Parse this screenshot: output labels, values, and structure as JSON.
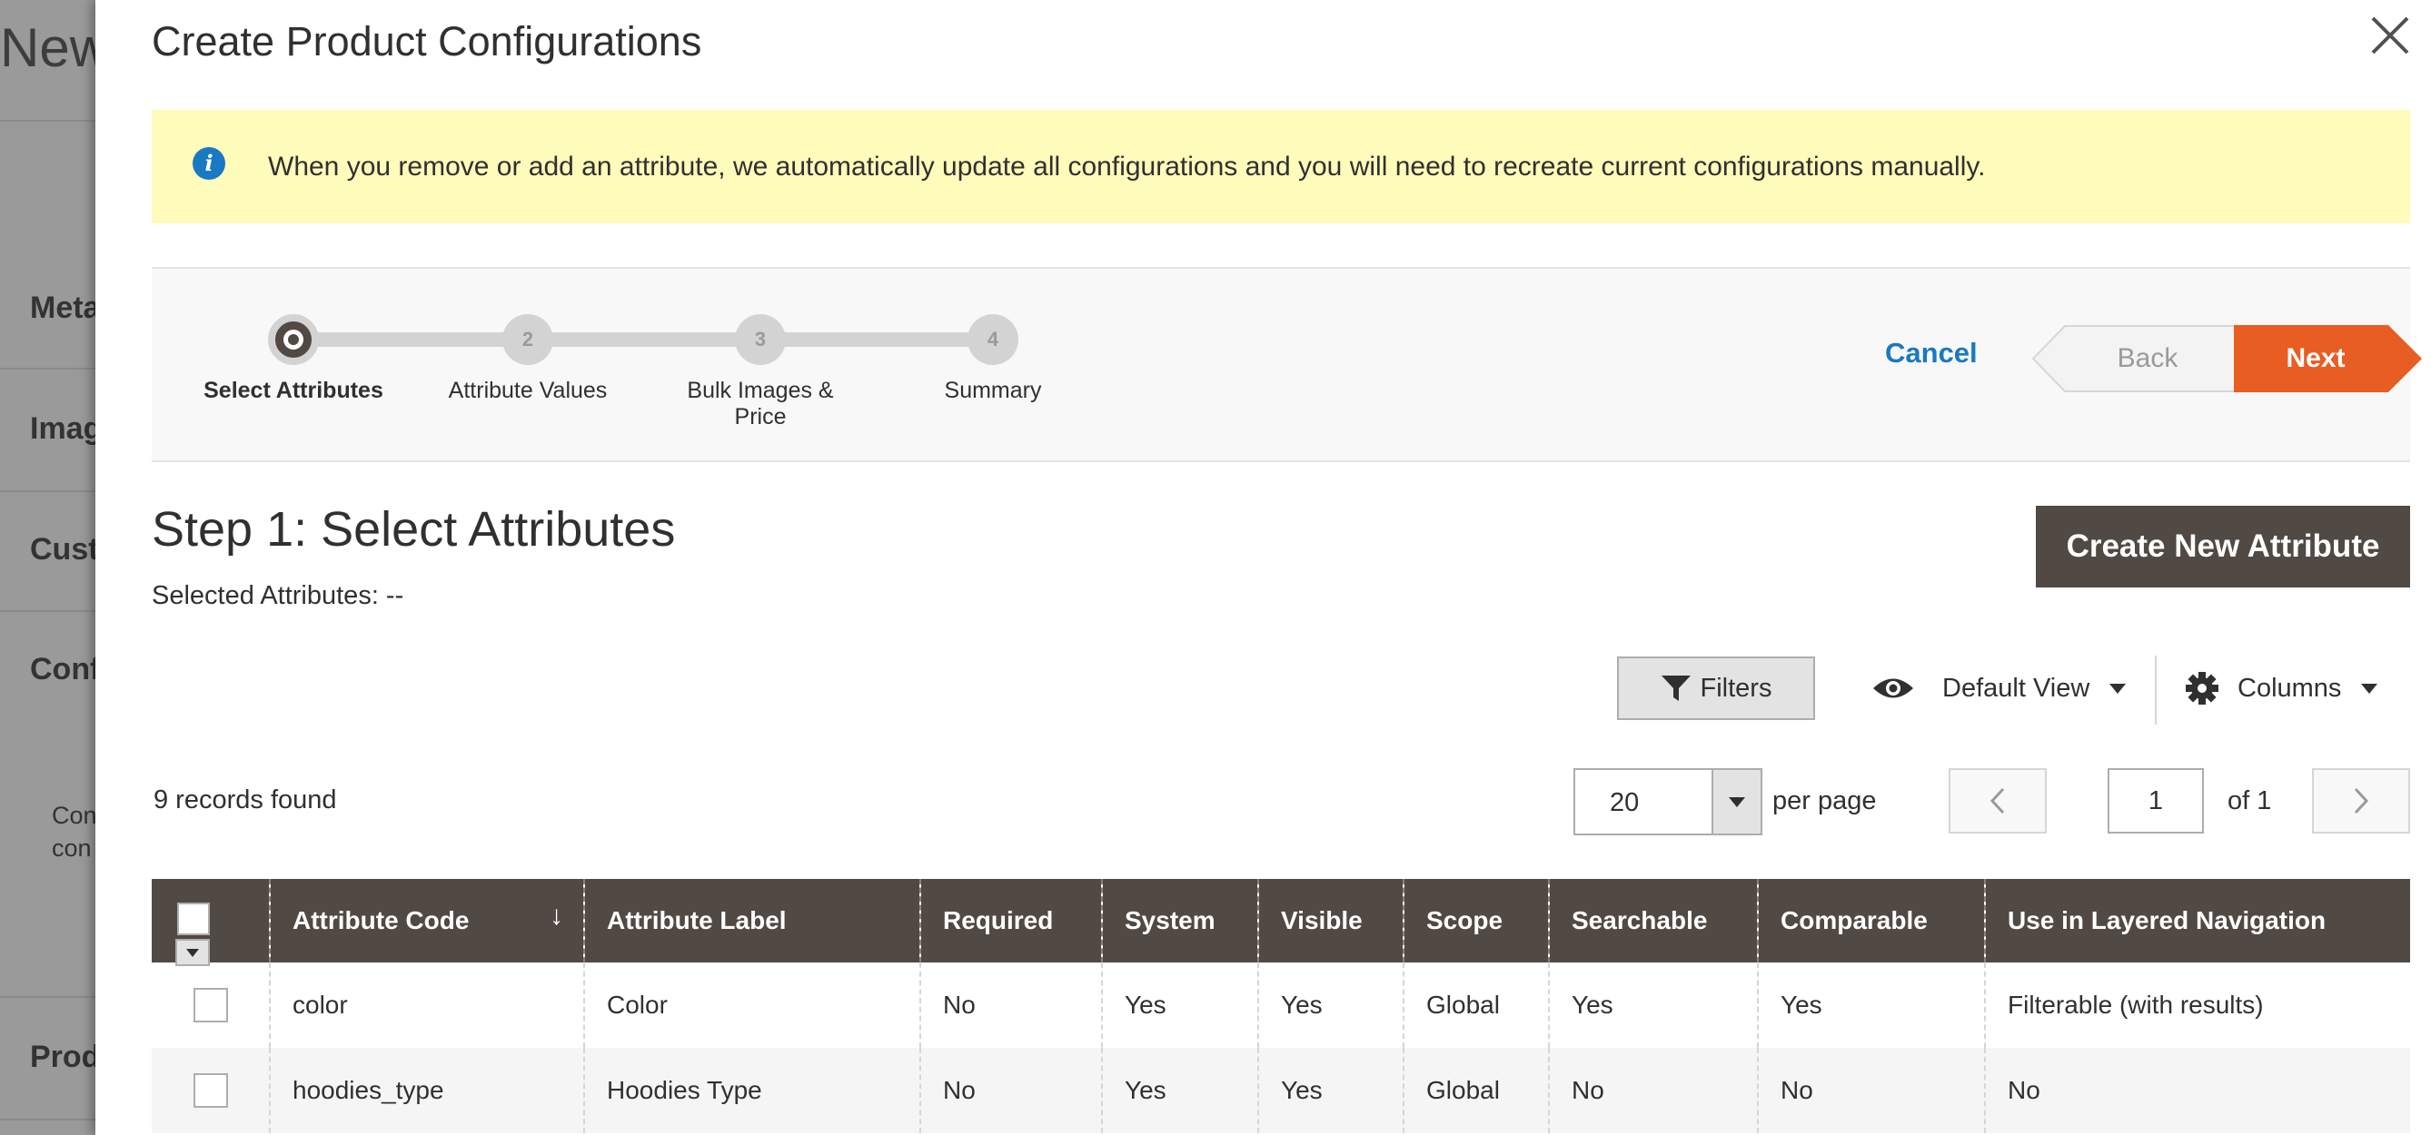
{
  "background": {
    "title": "New",
    "sections": [
      "Meta",
      "Imag",
      "Cust",
      "Conf",
      "Prod"
    ],
    "text_lines": [
      "Con",
      "con"
    ]
  },
  "modal": {
    "title": "Create Product Configurations",
    "close_icon": "close-icon"
  },
  "notice": {
    "icon": "info-icon",
    "text": "When you remove or add an attribute, we automatically update all configurations and you will need to recreate current configurations manually."
  },
  "wizard": {
    "steps": [
      {
        "number": "1",
        "label": "Select Attributes",
        "active": true
      },
      {
        "number": "2",
        "label": "Attribute Values",
        "active": false
      },
      {
        "number": "3",
        "label": "Bulk Images & Price",
        "active": false
      },
      {
        "number": "4",
        "label": "Summary",
        "active": false
      }
    ],
    "cancel_label": "Cancel",
    "back_label": "Back",
    "next_label": "Next"
  },
  "step": {
    "heading": "Step 1: Select Attributes",
    "selected_label": "Selected Attributes: --",
    "create_button": "Create New Attribute"
  },
  "toolbar": {
    "filters_label": "Filters",
    "view_label": "Default View",
    "columns_label": "Columns",
    "records_found": "9 records found",
    "per_page_value": "20",
    "per_page_label": "per page",
    "page_value": "1",
    "page_of": "of 1"
  },
  "grid": {
    "columns": [
      "Attribute Code",
      "Attribute Label",
      "Required",
      "System",
      "Visible",
      "Scope",
      "Searchable",
      "Comparable",
      "Use in Layered Navigation"
    ],
    "sort_indicator": "↓",
    "rows": [
      [
        "color",
        "Color",
        "No",
        "Yes",
        "Yes",
        "Global",
        "Yes",
        "Yes",
        "Filterable (with results)"
      ],
      [
        "hoodies_type",
        "Hoodies Type",
        "No",
        "Yes",
        "Yes",
        "Global",
        "No",
        "No",
        "No"
      ]
    ]
  },
  "colors": {
    "accent_orange": "#e85d22",
    "dark_brown": "#514943",
    "link_blue": "#1979c3",
    "notice_yellow": "#fffbbb"
  }
}
